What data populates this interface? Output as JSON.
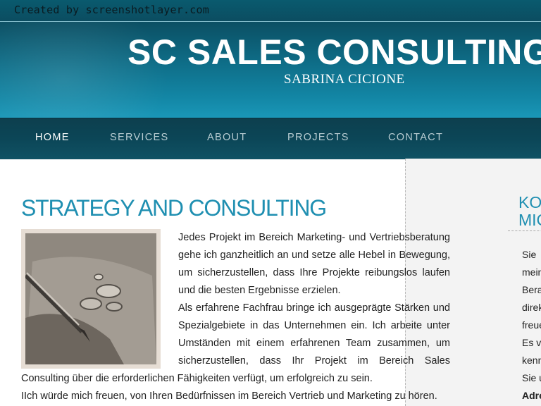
{
  "watermark": "Created by screenshotlayer.com",
  "header": {
    "title": "SC SALES CONSULTING",
    "subtitle": "SABRINA CICIONE"
  },
  "nav": {
    "items": [
      "HOME",
      "SERVICES",
      "ABOUT",
      "PROJECTS",
      "CONTACT"
    ],
    "active": "HOME"
  },
  "main": {
    "title": "STRATEGY AND CONSULTING",
    "image_icon": "coins-and-pen-photo",
    "paragraphs": [
      "Jedes Projekt im Bereich Marketing- und Vertriebsberatung gehe ich ganzheitlich an und setze alle Hebel in Bewegung, um sicherzustellen, dass Ihre Projekte reibungslos laufen und die besten Ergebnisse erzielen.",
      "Als erfahrene Fachfrau bringe ich ausgeprägte Stärken und Spezialgebiete in das Unternehmen ein. Ich arbeite unter Umständen mit einem erfahrenen Team zusammen, um sicherzustellen, dass Ihr Projekt im Bereich Sales Consulting über die erforderlichen Fähigkeiten verfügt, um erfolgreich zu sein.",
      "IIch würde mich freuen, von Ihren Bedürfnissen im Bereich Vertrieb und Marketing zu hören."
    ]
  },
  "sidebar": {
    "title_lines": [
      "KO",
      "MIC"
    ],
    "lines": [
      "Sie",
      "mein",
      "Bera",
      "direk",
      "freue",
      "Es v",
      "kenn",
      "Sie u",
      "Adre"
    ]
  },
  "colors": {
    "accent": "#1f8fb1",
    "header": "#0e6b85",
    "nav": "#0c4657"
  }
}
